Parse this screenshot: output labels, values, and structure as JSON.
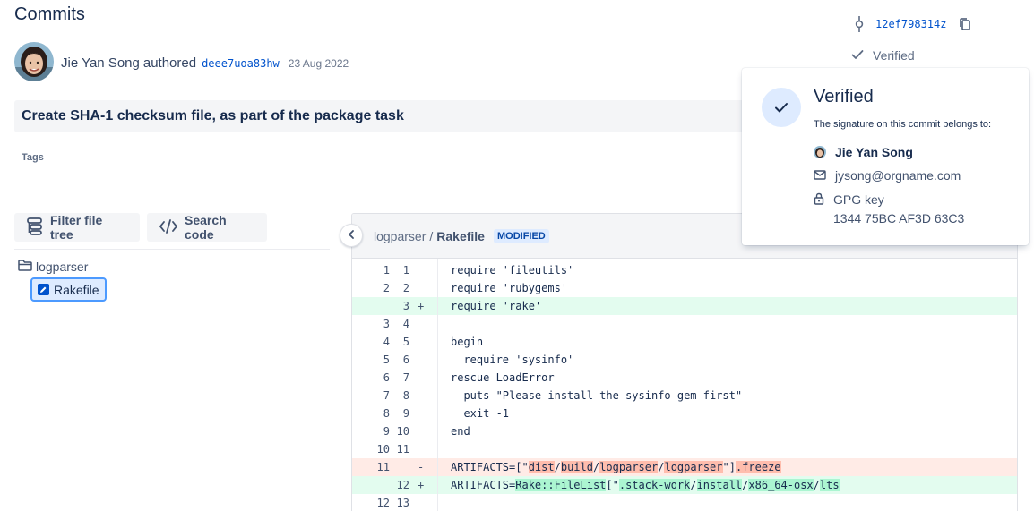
{
  "page": {
    "title": "Commits"
  },
  "commit": {
    "author": "Jie Yan Song",
    "verb": "authored",
    "short_hash": "deee7uoa83hw",
    "date": "23 Aug 2022",
    "ref_hash": "12ef798314z",
    "verified_label": "Verified",
    "message": "Create SHA-1 checksum file, as part of the package task",
    "tags_label": "Tags"
  },
  "toolbar": {
    "filter_label": "Filter file tree",
    "search_label": "Search code"
  },
  "file_tree": {
    "folder": "logparser",
    "file": "Rakefile"
  },
  "diff": {
    "folder": "logparser",
    "separator": "/",
    "file": "Rakefile",
    "status": "MODIFIED",
    "lines": [
      {
        "type": "context",
        "old": "1",
        "new": "1",
        "mark": "",
        "code": "require 'fileutils'"
      },
      {
        "type": "context",
        "old": "2",
        "new": "2",
        "mark": "",
        "code": "require 'rubygems'"
      },
      {
        "type": "added",
        "old": "",
        "new": "3",
        "mark": "+",
        "code": "require 'rake'"
      },
      {
        "type": "context",
        "old": "3",
        "new": "4",
        "mark": "",
        "code": ""
      },
      {
        "type": "context",
        "old": "4",
        "new": "5",
        "mark": "",
        "code": "begin"
      },
      {
        "type": "context",
        "old": "5",
        "new": "6",
        "mark": "",
        "code": "  require 'sysinfo'"
      },
      {
        "type": "context",
        "old": "6",
        "new": "7",
        "mark": "",
        "code": "rescue LoadError"
      },
      {
        "type": "context",
        "old": "7",
        "new": "8",
        "mark": "",
        "code": "  puts \"Please install the sysinfo gem first\""
      },
      {
        "type": "context",
        "old": "8",
        "new": "9",
        "mark": "",
        "code": "  exit -1"
      },
      {
        "type": "context",
        "old": "9",
        "new": "10",
        "mark": "",
        "code": "end"
      },
      {
        "type": "context",
        "old": "10",
        "new": "11",
        "mark": "",
        "code": ""
      },
      {
        "type": "removed",
        "old": "11",
        "new": "",
        "mark": "-",
        "code": "ARTIFACTS=[\"dist/build/logparser/logparser\"].freeze"
      },
      {
        "type": "added",
        "old": "",
        "new": "12",
        "mark": "+",
        "code": "ARTIFACTS=Rake::FileList[\".stack-work/install/x86_64-osx/lts"
      },
      {
        "type": "context",
        "old": "12",
        "new": "13",
        "mark": "",
        "code": ""
      }
    ]
  },
  "popover": {
    "title": "Verified",
    "subtitle": "The signature on this commit belongs to:",
    "name": "Jie Yan Song",
    "email": "jysong@orgname.com",
    "gpg_label": "GPG key",
    "gpg_value": "1344 75BC AF3D 63C3"
  },
  "colors": {
    "link": "#0052cc",
    "added_bg": "#e3fcef",
    "removed_bg": "#ffebe6",
    "added_hl": "#abf5d1",
    "removed_hl": "#ffbdad"
  },
  "icons": [
    "branch-icon",
    "copy-icon",
    "check-icon",
    "filter-icon",
    "code-icon",
    "folder-icon",
    "edit-file-icon",
    "chevron-left-icon",
    "mail-icon",
    "lock-icon"
  ]
}
